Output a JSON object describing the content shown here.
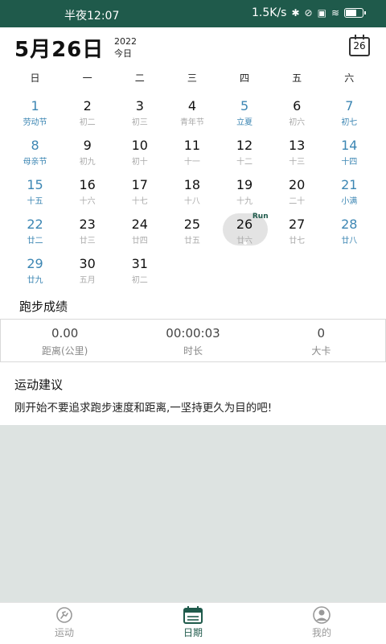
{
  "status_bar": {
    "time": "半夜12:07",
    "speed": "1.5K/s",
    "battery_level": 0.7,
    "icons": [
      "bluetooth-icon",
      "mute-icon",
      "sim-icon",
      "wifi-icon",
      "battery-icon"
    ]
  },
  "header": {
    "date": "5月26日",
    "year": "2022",
    "today_label": "今日",
    "calendar_button": "26"
  },
  "weekdays": [
    "日",
    "一",
    "二",
    "三",
    "四",
    "五",
    "六"
  ],
  "days": [
    {
      "num": "1",
      "sub": "劳动节",
      "hl": true
    },
    {
      "num": "2",
      "sub": "初二"
    },
    {
      "num": "3",
      "sub": "初三"
    },
    {
      "num": "4",
      "sub": "青年节"
    },
    {
      "num": "5",
      "sub": "立夏",
      "hl": true
    },
    {
      "num": "6",
      "sub": "初六"
    },
    {
      "num": "7",
      "sub": "初七",
      "hl": true
    },
    {
      "num": "8",
      "sub": "母亲节",
      "hl": true
    },
    {
      "num": "9",
      "sub": "初九"
    },
    {
      "num": "10",
      "sub": "初十"
    },
    {
      "num": "11",
      "sub": "十一"
    },
    {
      "num": "12",
      "sub": "十二"
    },
    {
      "num": "13",
      "sub": "十三"
    },
    {
      "num": "14",
      "sub": "十四",
      "hl": true
    },
    {
      "num": "15",
      "sub": "十五",
      "hl": true
    },
    {
      "num": "16",
      "sub": "十六"
    },
    {
      "num": "17",
      "sub": "十七"
    },
    {
      "num": "18",
      "sub": "十八"
    },
    {
      "num": "19",
      "sub": "十九"
    },
    {
      "num": "20",
      "sub": "二十"
    },
    {
      "num": "21",
      "sub": "小满",
      "hl": true
    },
    {
      "num": "22",
      "sub": "廿二",
      "hl": true
    },
    {
      "num": "23",
      "sub": "廿三"
    },
    {
      "num": "24",
      "sub": "廿四"
    },
    {
      "num": "25",
      "sub": "廿五"
    },
    {
      "num": "26",
      "sub": "廿六",
      "today": true,
      "run": "Run"
    },
    {
      "num": "27",
      "sub": "廿七"
    },
    {
      "num": "28",
      "sub": "廿八",
      "hl": true
    },
    {
      "num": "29",
      "sub": "廿九",
      "hl": true
    },
    {
      "num": "30",
      "sub": "五月"
    },
    {
      "num": "31",
      "sub": "初二"
    }
  ],
  "results": {
    "title": "跑步成绩",
    "distance": {
      "value": "0.00",
      "label": "距离(公里)"
    },
    "duration": {
      "value": "00:00:03",
      "label": "时长"
    },
    "calories": {
      "value": "0",
      "label": "大卡"
    }
  },
  "advice": {
    "title": "运动建议",
    "text": "刚开始不要追求跑步速度和距离,一坚持更久为目的吧!"
  },
  "tabs": [
    {
      "label": "运动",
      "icon": "run-icon"
    },
    {
      "label": "日期",
      "icon": "calendar-icon",
      "active": true
    },
    {
      "label": "我的",
      "icon": "profile-icon"
    }
  ],
  "colors": {
    "primary": "#1f5a4b",
    "highlight": "#3c86b3",
    "background": "#dde3e1"
  }
}
